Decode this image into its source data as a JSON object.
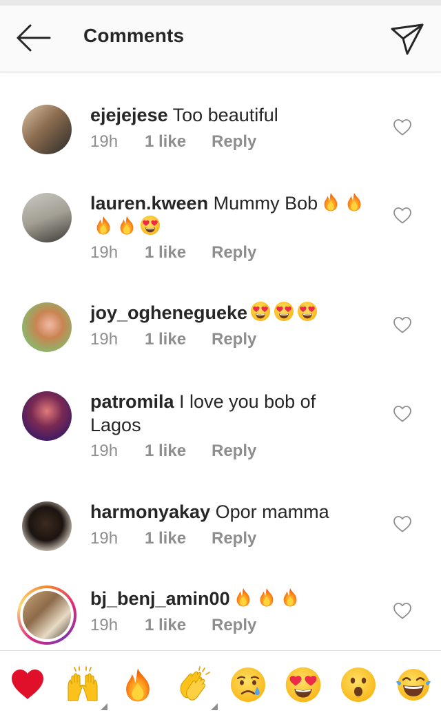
{
  "header": {
    "title": "Comments",
    "back_icon": "arrow-left-icon",
    "send_icon": "paper-plane-icon"
  },
  "comments": [
    {
      "username": "ejejejese",
      "text": "Too beautiful",
      "emojis": [],
      "time": "19h",
      "likes": "1 like",
      "reply": "Reply"
    },
    {
      "username": "lauren.kween",
      "text": "Mummy Bob",
      "emojis": [
        "fire",
        "fire",
        "fire",
        "fire",
        "heart-eyes"
      ],
      "time": "19h",
      "likes": "1 like",
      "reply": "Reply"
    },
    {
      "username": "joy_oghenegueke",
      "text": "",
      "emojis": [
        "heart-eyes",
        "heart-eyes",
        "heart-eyes"
      ],
      "time": "19h",
      "likes": "1 like",
      "reply": "Reply"
    },
    {
      "username": "patromila",
      "text": "I love you bob of Lagos",
      "emojis": [],
      "time": "19h",
      "likes": "1 like",
      "reply": "Reply"
    },
    {
      "username": "harmonyakay",
      "text": "Opor mamma",
      "emojis": [],
      "time": "19h",
      "likes": "1 like",
      "reply": "Reply"
    },
    {
      "username": "bj_benj_amin00",
      "text": "",
      "emojis": [
        "fire",
        "fire",
        "fire"
      ],
      "time": "19h",
      "likes": "1 like",
      "reply": "Reply"
    }
  ],
  "reactions": [
    "red-heart",
    "raised-hands",
    "fire",
    "clapping-hands",
    "crying-face",
    "heart-eyes",
    "surprised-face",
    "tears-of-joy"
  ],
  "colors": {
    "text": "#262626",
    "secondary": "#8e8e8e",
    "header_bg": "#fafafa",
    "divider": "#dbdbdb"
  }
}
